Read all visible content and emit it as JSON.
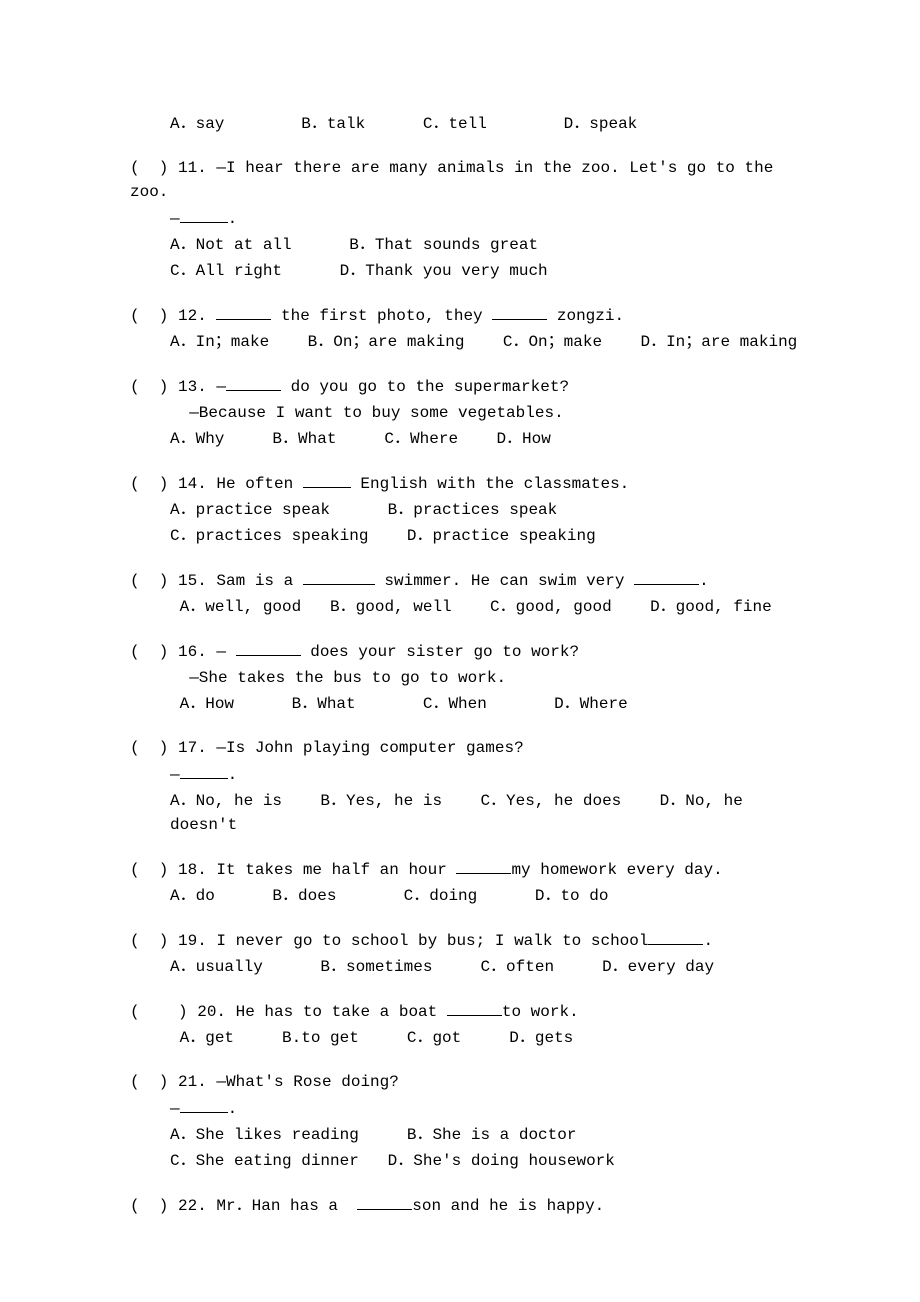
{
  "questions": [
    {
      "num": "",
      "lines": [
        {
          "cls": "sub",
          "text": "A．say        B．talk      C．tell        D．speak"
        }
      ]
    },
    {
      "num": "11",
      "lines": [
        {
          "cls": "main",
          "text": "(  ) 11. —I hear there are many animals in the zoo. Let's go to the zoo."
        },
        {
          "cls": "sub",
          "html": "—<span class='blank w40'></span>."
        },
        {
          "cls": "sub",
          "text": "A．Not at all      B．That sounds great"
        },
        {
          "cls": "sub",
          "text": "C．All right      D．Thank you very much"
        }
      ]
    },
    {
      "num": "12",
      "lines": [
        {
          "cls": "main",
          "html": "(  ) 12. <span class='blank w50'></span> the first photo, they <span class='blank w50'></span> zongzi."
        },
        {
          "cls": "sub",
          "text": "A．In；make    B．On；are making    C．On；make    D．In；are making"
        }
      ]
    },
    {
      "num": "13",
      "lines": [
        {
          "cls": "main",
          "html": "(  ) 13. —<span class='blank w50'></span> do you go to the supermarket?"
        },
        {
          "cls": "sub",
          "text": "  —Because I want to buy some vegetables."
        },
        {
          "cls": "sub",
          "text": "A．Why     B．What     C．Where    D．How"
        }
      ]
    },
    {
      "num": "14",
      "lines": [
        {
          "cls": "main",
          "html": "(  ) 14. He often <span class='blank w40'></span> English with the classmates."
        },
        {
          "cls": "sub",
          "text": "A．practice speak      B．practices speak"
        },
        {
          "cls": "sub",
          "text": "C．practices speaking    D．practice speaking"
        }
      ]
    },
    {
      "num": "15",
      "lines": [
        {
          "cls": "main",
          "html": "(  ) 15. Sam is a <span class='blank w70'></span> swimmer. He can swim very <span class='blank w60'></span>."
        },
        {
          "cls": "sub",
          "text": " A．well, good   B．good, well    C．good, good    D．good, fine"
        }
      ]
    },
    {
      "num": "16",
      "lines": [
        {
          "cls": "main",
          "html": "(  ) 16. — <span class='blank w60'></span> does your sister go to work?"
        },
        {
          "cls": "sub",
          "text": "  —She takes the bus to go to work."
        },
        {
          "cls": "sub",
          "text": " A．How      B．What       C．When       D．Where"
        }
      ]
    },
    {
      "num": "17",
      "lines": [
        {
          "cls": "main",
          "text": "(  ) 17. —Is John playing computer games?"
        },
        {
          "cls": "sub",
          "html": "—<span class='blank w40'></span>."
        },
        {
          "cls": "sub",
          "text": "A．No, he is    B．Yes, he is    C．Yes, he does    D．No, he doesn't"
        }
      ]
    },
    {
      "num": "18",
      "lines": [
        {
          "cls": "main",
          "html": "(  ) 18. It takes me half an hour <span class='blank w50'></span>my homework every day."
        },
        {
          "cls": "sub",
          "text": "A．do      B．does       C．doing      D．to do"
        }
      ]
    },
    {
      "num": "19",
      "lines": [
        {
          "cls": "main",
          "html": "(  ) 19. I never go to school by bus; I walk to school<span class='blank w50'></span>."
        },
        {
          "cls": "sub",
          "text": "A．usually      B．sometimes     C．often     D．every day"
        }
      ]
    },
    {
      "num": "20",
      "lines": [
        {
          "cls": "main",
          "html": "(    ) 20. He has to take a boat <span class='blank w50'></span>to work."
        },
        {
          "cls": "sub",
          "text": " A．get     B.to get     C．got     D．gets"
        }
      ]
    },
    {
      "num": "21",
      "lines": [
        {
          "cls": "main",
          "text": "(  ) 21. —What's Rose doing?"
        },
        {
          "cls": "sub",
          "html": "—<span class='blank w40'></span>."
        },
        {
          "cls": "sub",
          "text": "A．She likes reading     B．She is a doctor"
        },
        {
          "cls": "sub",
          "text": "C．She eating dinner   D．She's doing housework"
        }
      ]
    },
    {
      "num": "22",
      "lines": [
        {
          "cls": "main",
          "html": "(  ) 22. Mr．Han has a  <span class='blank w50'></span>son and he is happy."
        }
      ]
    }
  ]
}
